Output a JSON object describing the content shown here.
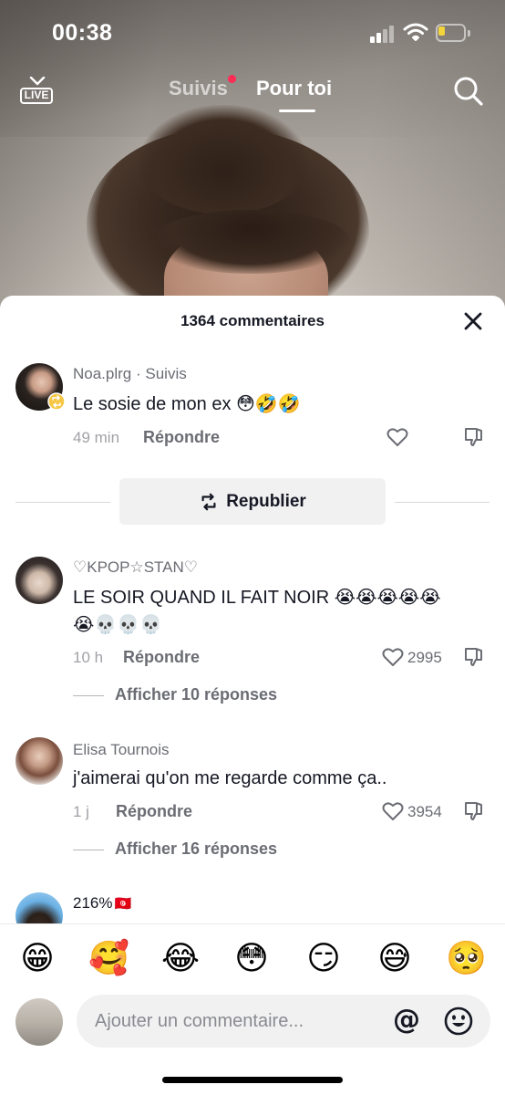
{
  "status_bar": {
    "time": "00:38",
    "battery_level": 0.15
  },
  "top_nav": {
    "live_label": "LIVE",
    "tabs": [
      {
        "label": "Suivis",
        "active": false,
        "has_dot": true
      },
      {
        "label": "Pour toi",
        "active": true
      }
    ]
  },
  "comments_sheet": {
    "header": "1364 commentaires",
    "repost_label": "Republier",
    "comments": [
      {
        "username": "Noa.plrg",
        "badge": " · Suivis",
        "text": "Le sosie de mon ex",
        "emojis": "😳🤣🤣",
        "text_line2": "",
        "time": "49 min",
        "reply_label": "Répondre",
        "likes": "",
        "view_replies": ""
      },
      {
        "username": "♡KPOP☆STAN♡",
        "badge": "",
        "text": "LE SOIR QUAND IL FAIT NOIR",
        "emojis": "😭😭😭😭😭",
        "text_line2": "😭💀💀💀",
        "time": "10 h",
        "reply_label": "Répondre",
        "likes": "2995",
        "view_replies": "Afficher 10 réponses"
      },
      {
        "username": "Elisa Tournois",
        "badge": "",
        "text": "j'aimerai qu'on me regarde comme ça..",
        "emojis": "",
        "text_line2": "",
        "time": "1 j",
        "reply_label": "Répondre",
        "likes": "3954",
        "view_replies": "Afficher 16 réponses"
      },
      {
        "username": "216%",
        "flag": "🇹🇳"
      }
    ]
  },
  "emoji_bar": [
    "😁",
    "🥰",
    "😂",
    "😳",
    "😏",
    "😅",
    "🥺"
  ],
  "input": {
    "placeholder": "Ajouter un commentaire...",
    "mention_symbol": "@"
  },
  "colors": {
    "accent": "#fe2c55",
    "text_primary": "#161823",
    "text_secondary": "#6b6d74"
  },
  "icons": [
    "live-icon",
    "search-icon",
    "close-icon",
    "heart-icon",
    "dislike-icon",
    "repost-icon",
    "emoji-icon"
  ]
}
